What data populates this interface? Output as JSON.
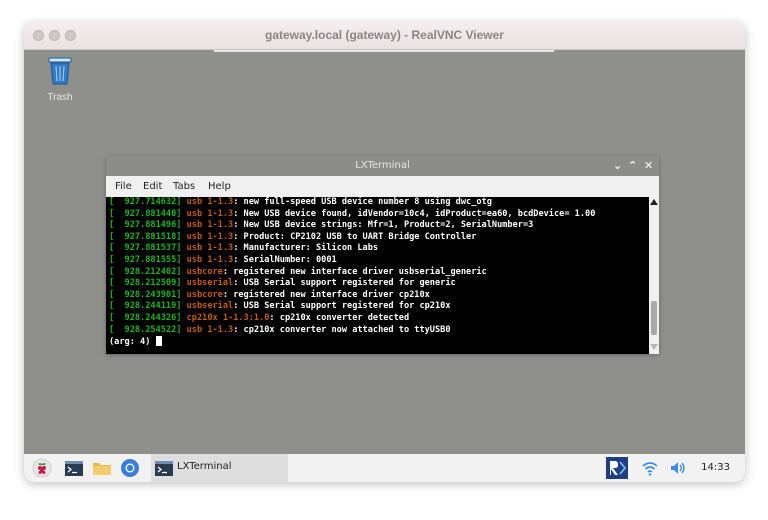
{
  "window": {
    "title": "gateway.local (gateway) - RealVNC Viewer"
  },
  "desktop": {
    "trash_label": "Trash"
  },
  "terminal_window": {
    "title": "LXTerminal",
    "controls": [
      "⌄",
      "⌃",
      "✕"
    ],
    "menu": [
      "File",
      "Edit",
      "Tabs",
      "Help"
    ]
  },
  "terminal": {
    "lines": [
      {
        "ts": "[  927.714632]",
        "dev": "usb 1-1.3",
        "msg": ": new full-speed USB device number 8 using dwc_otg"
      },
      {
        "ts": "[  927.881440]",
        "dev": "usb 1-1.3",
        "msg": ": New USB device found, idVendor=10c4, idProduct=ea60, bcdDevice= 1.00"
      },
      {
        "ts": "[  927.881496]",
        "dev": "usb 1-1.3",
        "msg": ": New USB device strings: Mfr=1, Product=2, SerialNumber=3"
      },
      {
        "ts": "[  927.881518]",
        "dev": "usb 1-1.3",
        "msg": ": Product: CP2102 USB to UART Bridge Controller"
      },
      {
        "ts": "[  927.881537]",
        "dev": "usb 1-1.3",
        "msg": ": Manufacturer: Silicon Labs"
      },
      {
        "ts": "[  927.881555]",
        "dev": "usb 1-1.3",
        "msg": ": SerialNumber: 0001"
      },
      {
        "ts": "[  928.212402]",
        "dev": "usbcore",
        "msg": ": registered new interface driver usbserial_generic"
      },
      {
        "ts": "[  928.212509]",
        "dev": "usbserial",
        "msg": ": USB Serial support registered for generic"
      },
      {
        "ts": "[  928.243901]",
        "dev": "usbcore",
        "msg": ": registered new interface driver cp210x"
      },
      {
        "ts": "[  928.244119]",
        "dev": "usbserial",
        "msg": ": USB Serial support registered for cp210x"
      },
      {
        "ts": "[  928.244326]",
        "dev": "cp210x 1-1.3:1.0",
        "msg": ": cp210x converter detected"
      },
      {
        "ts": "[  928.254522]",
        "dev": "usb 1-1.3",
        "msg": ": cp210x converter now attached to ttyUSB0"
      }
    ],
    "prompt": "(arg: 4) "
  },
  "taskbar": {
    "active_task_label": "LXTerminal",
    "clock": "14:33"
  },
  "colors": {
    "timestamp": "#1eb51e",
    "device": "#c45d0f",
    "terminal_bg": "#000000",
    "desktop_bg": "#8f8f8c"
  }
}
